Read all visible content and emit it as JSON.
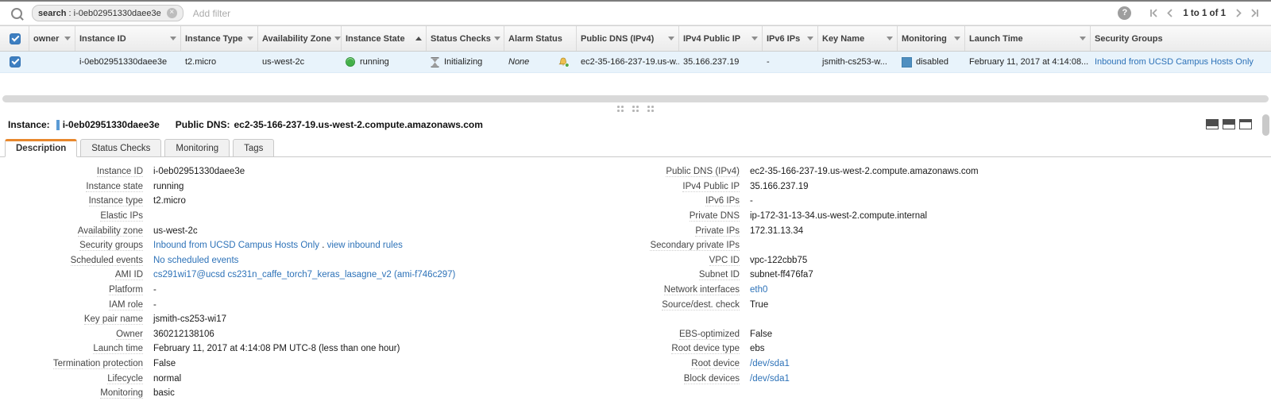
{
  "topbar": {
    "search_tag": {
      "bold": "search",
      "sep": " : ",
      "value": "i-0eb02951330daee3e"
    },
    "add_filter": "Add filter",
    "pagination_text": "1 to 1 of 1"
  },
  "table": {
    "columns": [
      {
        "type": "checkbox",
        "label": ""
      },
      {
        "label": "owner",
        "arrow": "filter"
      },
      {
        "label": "Instance ID",
        "arrow": "filter"
      },
      {
        "label": "Instance Type",
        "arrow": "filter"
      },
      {
        "label": "Availability Zone",
        "arrow": "filter"
      },
      {
        "label": "Instance State",
        "arrow": "sort-asc"
      },
      {
        "label": "Status Checks",
        "arrow": "filter"
      },
      {
        "label": "Alarm Status"
      },
      {
        "label": "Public DNS (IPv4)",
        "arrow": "filter"
      },
      {
        "label": "IPv4 Public IP",
        "arrow": "filter"
      },
      {
        "label": "IPv6 IPs",
        "arrow": "filter"
      },
      {
        "label": "Key Name",
        "arrow": "filter"
      },
      {
        "label": "Monitoring",
        "arrow": "filter"
      },
      {
        "label": "Launch Time",
        "arrow": "filter"
      },
      {
        "label": "Security Groups"
      }
    ],
    "row": {
      "selected": true,
      "cells": [
        {
          "type": "checkbox"
        },
        {
          "type": "text",
          "text": ""
        },
        {
          "type": "text",
          "text": "i-0eb02951330daee3e"
        },
        {
          "type": "text",
          "text": "t2.micro"
        },
        {
          "type": "text",
          "text": "us-west-2c"
        },
        {
          "type": "status",
          "text": "running"
        },
        {
          "type": "statuscheck",
          "text": "Initializing"
        },
        {
          "type": "alarm",
          "text": "None"
        },
        {
          "type": "text",
          "text": "ec2-35-166-237-19.us-w.."
        },
        {
          "type": "text",
          "text": "35.166.237.19"
        },
        {
          "type": "text",
          "text": "-"
        },
        {
          "type": "text",
          "text": "jsmith-cs253-w..."
        },
        {
          "type": "monitoring",
          "text": "disabled"
        },
        {
          "type": "text",
          "text": "February 11, 2017 at 4:14:08..."
        },
        {
          "type": "link",
          "text": "Inbound from UCSD Campus Hosts Only"
        }
      ]
    }
  },
  "detail": {
    "instance_label": "Instance:",
    "instance_id": "i-0eb02951330daee3e",
    "dns_label": "Public DNS:",
    "dns_value": "ec2-35-166-237-19.us-west-2.compute.amazonaws.com",
    "tabs": [
      {
        "label": "Description",
        "active": true
      },
      {
        "label": "Status Checks",
        "active": false
      },
      {
        "label": "Monitoring",
        "active": false
      },
      {
        "label": "Tags",
        "active": false
      }
    ]
  },
  "description": {
    "left": [
      {
        "label": "Instance ID",
        "value": "i-0eb02951330daee3e"
      },
      {
        "label": "Instance state",
        "value": "running"
      },
      {
        "label": "Instance type",
        "value": "t2.micro"
      },
      {
        "label": "Elastic IPs",
        "value": ""
      },
      {
        "label": "Availability zone",
        "value": "us-west-2c"
      },
      {
        "label": "Security groups",
        "parts": [
          {
            "text": "Inbound from UCSD Campus Hosts Only",
            "link": true
          },
          {
            "text": " . ",
            "link": false
          },
          {
            "text": "view inbound rules",
            "link": true
          }
        ]
      },
      {
        "label": "Scheduled events",
        "value": "No scheduled events",
        "link": true
      },
      {
        "label": "AMI ID",
        "value": "cs291wi17@ucsd cs231n_caffe_torch7_keras_lasagne_v2 (ami-f746c297)",
        "link": true
      },
      {
        "label": "Platform",
        "value": "-"
      },
      {
        "label": "IAM role",
        "value": "-"
      },
      {
        "label": "Key pair name",
        "value": "jsmith-cs253-wi17"
      },
      {
        "label": "Owner",
        "value": "360212138106"
      },
      {
        "label": "Launch time",
        "value": "February 11, 2017 at 4:14:08 PM UTC-8 (less than one hour)"
      },
      {
        "label": "Termination protection",
        "value": "False"
      },
      {
        "label": "Lifecycle",
        "value": "normal"
      },
      {
        "label": "Monitoring",
        "value": "basic"
      }
    ],
    "right": [
      {
        "label": "Public DNS (IPv4)",
        "value": "ec2-35-166-237-19.us-west-2.compute.amazonaws.com"
      },
      {
        "label": "IPv4 Public IP",
        "value": "35.166.237.19"
      },
      {
        "label": "IPv6 IPs",
        "value": "-"
      },
      {
        "label": "Private DNS",
        "value": "ip-172-31-13-34.us-west-2.compute.internal"
      },
      {
        "label": "Private IPs",
        "value": "172.31.13.34"
      },
      {
        "label": "Secondary private IPs",
        "value": ""
      },
      {
        "label": "VPC ID",
        "value": "vpc-122cbb75"
      },
      {
        "label": "Subnet ID",
        "value": "subnet-ff476fa7"
      },
      {
        "label": "Network interfaces",
        "value": "eth0",
        "link": true
      },
      {
        "label": "Source/dest. check",
        "value": "True"
      },
      {
        "label": "",
        "value": ""
      },
      {
        "label": "EBS-optimized",
        "value": "False"
      },
      {
        "label": "Root device type",
        "value": "ebs"
      },
      {
        "label": "Root device",
        "value": "/dev/sda1",
        "link": true
      },
      {
        "label": "Block devices",
        "value": "/dev/sda1",
        "link": true
      }
    ]
  },
  "colors": {
    "accent_orange": "#e8882d",
    "link_blue": "#2d72b8",
    "running_green": "#43b049",
    "selected_row_bg": "#e8f3fb",
    "checkbox_blue": "#3e7fc1",
    "monitoring_blue": "#4f8fc0"
  }
}
